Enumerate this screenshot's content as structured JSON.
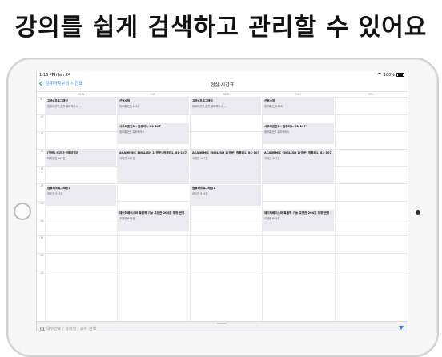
{
  "headline": "강의를 쉽게 검색하고 관리할 수 있어요",
  "status": {
    "time": "1:16 PM",
    "date": "Fri Jan 24",
    "battery": "100%"
  },
  "nav": {
    "back_label": "컴퓨터학부의 시간표",
    "title": "현실 시간표"
  },
  "days": [
    "MON",
    "TUE",
    "WED",
    "THU",
    "FRI"
  ],
  "hours": [
    "9",
    "10",
    "11",
    "12",
    "13",
    "14",
    "15",
    "16",
    "17",
    "18",
    "19"
  ],
  "events": [
    {
      "title": "고급C프로그래밍",
      "sub": "컴퓨터공학 본관 유비쿼터스 ..."
    },
    {
      "title": "선형수학",
      "sub": "정보통신관(105)"
    },
    {
      "title": "고급C프로그래밍",
      "sub": "컴퓨터공학 본관 유비쿼터스 ..."
    },
    {
      "title": "선형수학",
      "sub": "정보통신관(105)"
    },
    {
      "title": "사고와표현1 : 컴퓨터1, 81-107",
      "sub": "정보통신관 유비쿼터스"
    },
    {
      "title": "사고와표현1 : 컴퓨터1, 81-107",
      "sub": "정보통신관 유비쿼터스"
    },
    {
      "title": "[역량] 세미나-컴퓨터학과",
      "sub": "미래융합 107호"
    },
    {
      "title": "ACADEMIC ENGLISH 1(영문) 컴퓨터1, 81-107",
      "sub": "국제관 107호"
    },
    {
      "title": "ACADEMIC ENGLISH 1(영문) 컴퓨터1, 81-107",
      "sub": "국제관 107호"
    },
    {
      "title": "ACADEMIC ENGLISH 1(영문) 컴퓨터1, 81-107",
      "sub": "국제관 107호"
    },
    {
      "title": "컴퓨터프로그래밍1",
      "sub": "과도관 915호"
    },
    {
      "title": "컴퓨터프로그래밍1",
      "sub": "과도관 915호"
    },
    {
      "title": "데이터베이스와 확률적 기능 교양관 204호 예정 변경",
      "sub": "교양관 605호"
    },
    {
      "title": "데이터베이스와 확률적 기능 교양관 204호 예정 변경",
      "sub": "교양관 605호"
    }
  ],
  "search": {
    "placeholder": "학수번호 / 강의명 / 교수 검색"
  }
}
